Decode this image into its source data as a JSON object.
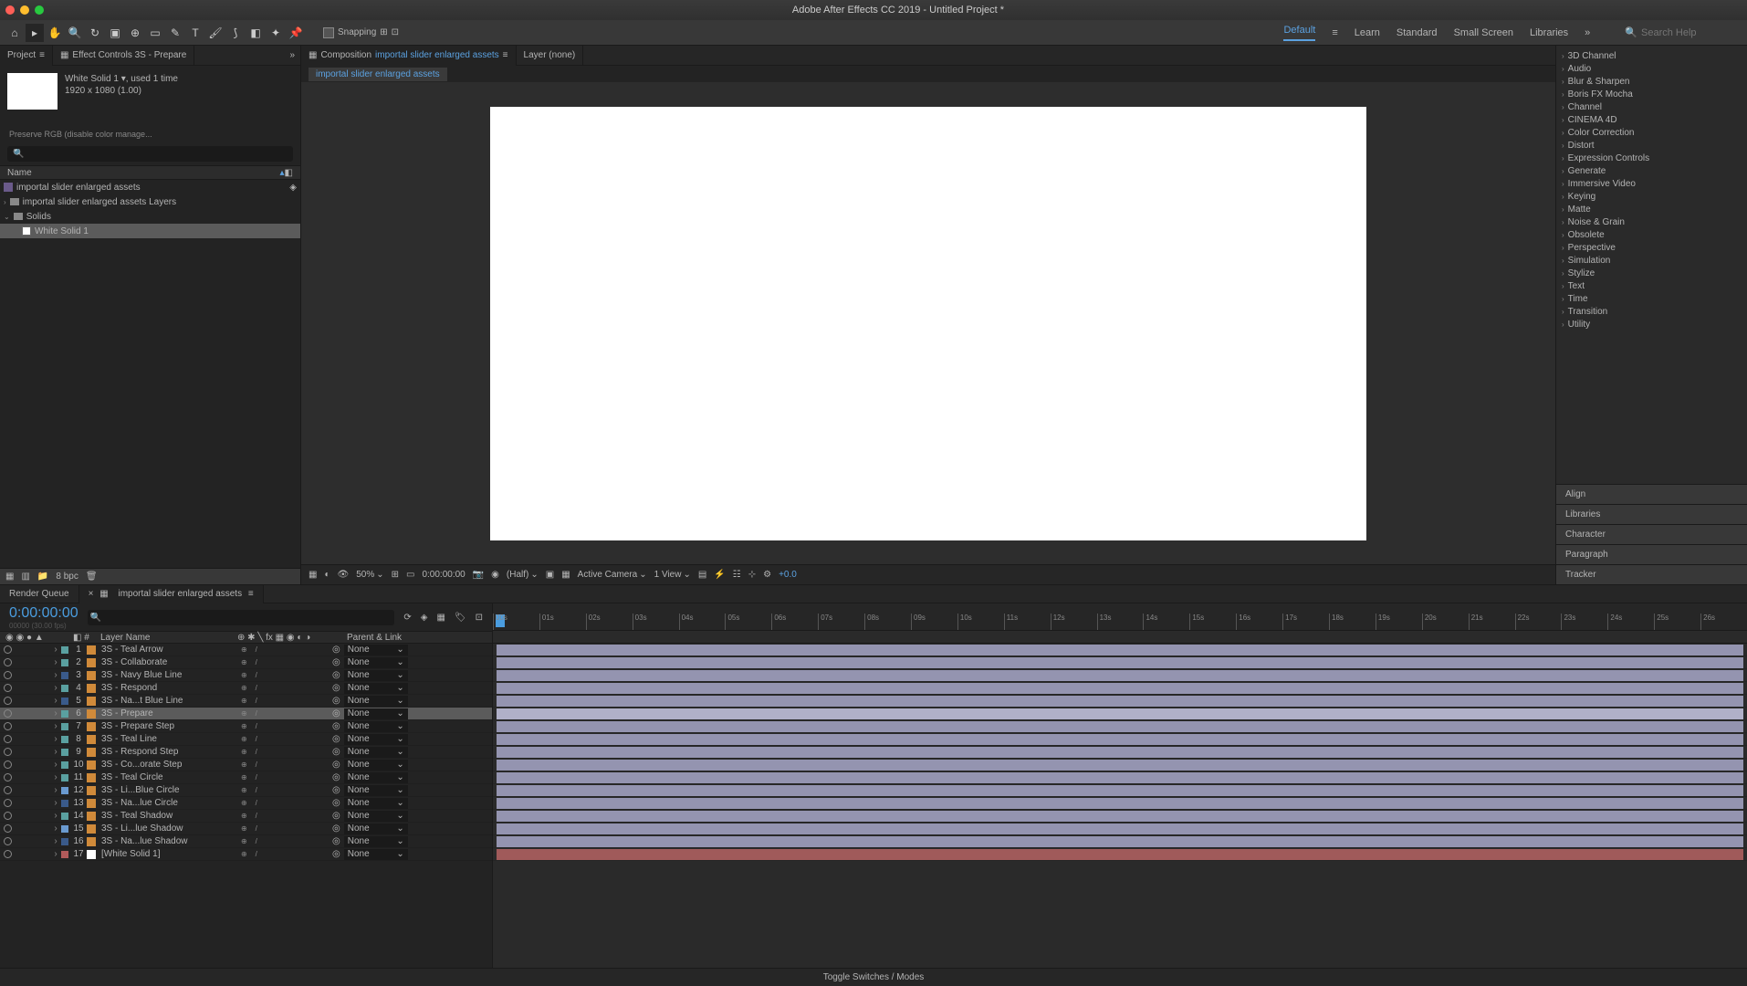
{
  "app": {
    "title": "Adobe After Effects CC 2019 - Untitled Project *"
  },
  "toolbar": {
    "snapping": "Snapping"
  },
  "workspaces": {
    "default": "Default",
    "learn": "Learn",
    "standard": "Standard",
    "small": "Small Screen",
    "libraries": "Libraries",
    "search": "Search Help"
  },
  "projectPanel": {
    "tab1": "Project",
    "tab2": "Effect Controls 3S - Prepare",
    "selName": "White Solid 1 ▾",
    "selUsed": ", used 1 time",
    "selDims": "1920 x 1080 (1.00)",
    "preserve": "Preserve RGB (disable color manage...",
    "headerName": "Name",
    "items": [
      "importal slider enlarged assets",
      "importal slider enlarged assets Layers",
      "Solids",
      "White Solid 1"
    ],
    "bpc": "8 bpc"
  },
  "compPanel": {
    "tabPrefix": "Composition ",
    "tabName": "importal slider enlarged assets",
    "layerTab": "Layer (none)",
    "flowchart": "importal slider enlarged assets"
  },
  "viewer": {
    "zoom": "50%",
    "time": "0:00:00:00",
    "res": "(Half)",
    "camera": "Active Camera",
    "view": "1 View",
    "exposure": "+0.0"
  },
  "effects": {
    "cats": [
      "3D Channel",
      "Audio",
      "Blur & Sharpen",
      "Boris FX Mocha",
      "Channel",
      "CINEMA 4D",
      "Color Correction",
      "Distort",
      "Expression Controls",
      "Generate",
      "Immersive Video",
      "Keying",
      "Matte",
      "Noise & Grain",
      "Obsolete",
      "Perspective",
      "Simulation",
      "Stylize",
      "Text",
      "Time",
      "Transition",
      "Utility"
    ]
  },
  "sidePanels": [
    "Align",
    "Libraries",
    "Character",
    "Paragraph",
    "Tracker"
  ],
  "timeline": {
    "tab1": "Render Queue",
    "tab2": "importal slider enlarged assets",
    "timecode": "0:00:00:00",
    "timesub": "00000 (30.00 fps)",
    "colLayerName": "Layer Name",
    "colParent": "Parent & Link",
    "ticks": [
      "00s",
      "01s",
      "02s",
      "03s",
      "04s",
      "05s",
      "06s",
      "07s",
      "08s",
      "09s",
      "10s",
      "11s",
      "12s",
      "13s",
      "14s",
      "15s",
      "16s",
      "17s",
      "18s",
      "19s",
      "20s",
      "21s",
      "22s",
      "23s",
      "24s",
      "25s",
      "26s"
    ],
    "layers": [
      {
        "n": 1,
        "name": "3S - Teal Arrow",
        "c": "#5aa0a0"
      },
      {
        "n": 2,
        "name": "3S - Collaborate",
        "c": "#5aa0a0"
      },
      {
        "n": 3,
        "name": "3S - Navy Blue Line",
        "c": "#3a5a8a"
      },
      {
        "n": 4,
        "name": "3S - Respond",
        "c": "#5aa0a0"
      },
      {
        "n": 5,
        "name": "3S - Na...t Blue Line",
        "c": "#3a5a8a"
      },
      {
        "n": 6,
        "name": "3S - Prepare",
        "c": "#5aa0a0",
        "sel": true
      },
      {
        "n": 7,
        "name": "3S - Prepare Step",
        "c": "#5aa0a0"
      },
      {
        "n": 8,
        "name": "3S - Teal Line",
        "c": "#5aa0a0"
      },
      {
        "n": 9,
        "name": "3S - Respond Step",
        "c": "#5aa0a0"
      },
      {
        "n": 10,
        "name": "3S - Co...orate Step",
        "c": "#5aa0a0"
      },
      {
        "n": 11,
        "name": "3S - Teal Circle",
        "c": "#5aa0a0"
      },
      {
        "n": 12,
        "name": "3S - Li...Blue Circle",
        "c": "#6a9ad0"
      },
      {
        "n": 13,
        "name": "3S - Na...lue Circle",
        "c": "#3a5a8a"
      },
      {
        "n": 14,
        "name": "3S - Teal Shadow",
        "c": "#5aa0a0"
      },
      {
        "n": 15,
        "name": "3S - Li...lue Shadow",
        "c": "#6a9ad0"
      },
      {
        "n": 16,
        "name": "3S - Na...lue Shadow",
        "c": "#3a5a8a"
      },
      {
        "n": 17,
        "name": "[White Solid 1]",
        "c": "#b05a5a",
        "solid": true
      }
    ],
    "parentNone": "None",
    "footer": "Toggle Switches / Modes"
  }
}
